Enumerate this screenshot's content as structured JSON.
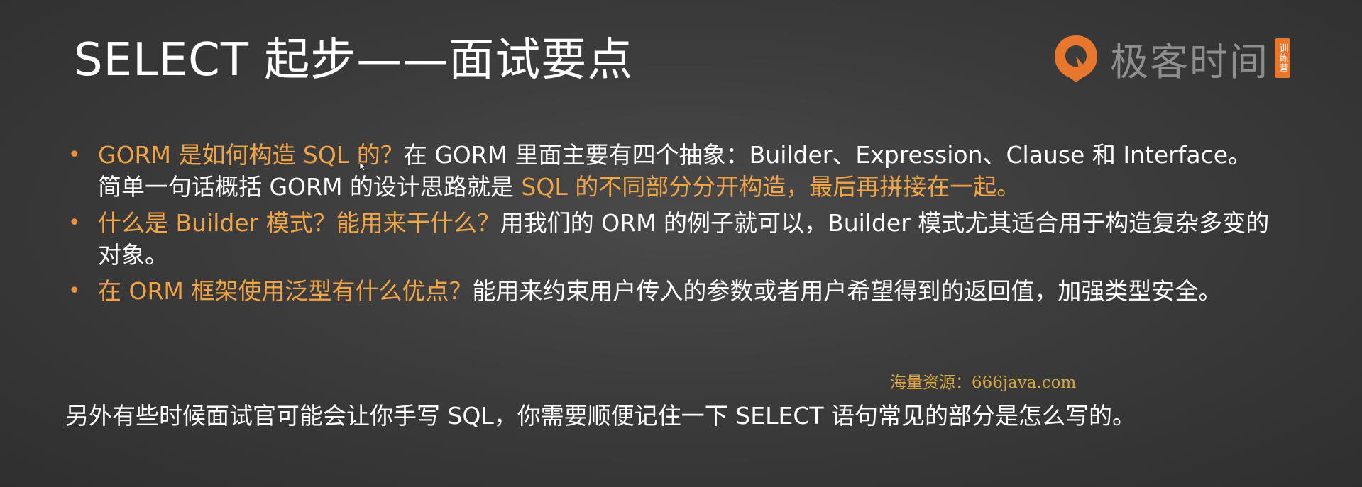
{
  "slide": {
    "title": "SELECT 起步——面试要点",
    "logo": {
      "text": "极客时间",
      "badge": "训练营",
      "icon": "geektime-logo-icon",
      "accent_color": "#e8772e"
    },
    "bullets": [
      {
        "question": "GORM 是如何构造 SQL 的？",
        "answer_part1": "在 GORM 里面主要有四个抽象：Builder、Expression、Clause 和 Interface。简单一句话概括 GORM 的设计思路就是 ",
        "answer_highlight": "SQL 的不同部分分开构造，最后再拼接在一起。"
      },
      {
        "question": "什么是 Builder 模式？能用来干什么？",
        "answer": "用我们的 ORM 的例子就可以，Builder 模式尤其适合用于构造复杂多变的对象。"
      },
      {
        "question": "在 ORM 框架使用泛型有什么优点？",
        "answer": "能用来约束用户传入的参数或者用户希望得到的返回值，加强类型安全。"
      }
    ],
    "bullet_symbol": "•",
    "watermark": "海量资源：666java.com",
    "footer": "另外有些时候面试官可能会让你手写 SQL，你需要顺便记住一下 SELECT 语句常见的部分是怎么写的。"
  },
  "colors": {
    "background": "#3c3c3c",
    "text": "#ffffff",
    "highlight": "#f0a448",
    "watermark": "#d9a640"
  }
}
